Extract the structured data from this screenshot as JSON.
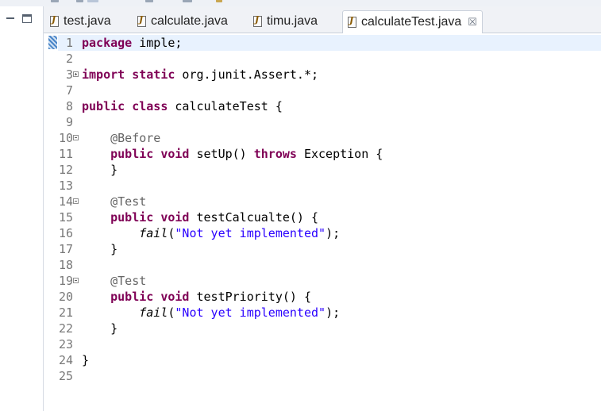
{
  "tabs": [
    {
      "label": "test.java",
      "active": false
    },
    {
      "label": "calculate.java",
      "active": false
    },
    {
      "label": "timu.java",
      "active": false
    },
    {
      "label": "calculateTest.java",
      "active": true
    }
  ],
  "tab_close_glyph": "☒",
  "icons": {
    "tab_file": "java-file-icon",
    "close": "close-icon",
    "minimize": "minimize-icon",
    "maximize": "maximize-icon"
  },
  "colors": {
    "keyword": "#7f0055",
    "annotation": "#646464",
    "string": "#2a00ff",
    "current_line": "#e8f2fe"
  },
  "editor": {
    "current_line": 1,
    "lines": [
      {
        "num": "1",
        "text": "package imple;",
        "segments": [
          [
            "kw",
            "package"
          ],
          [
            "",
            " imple;"
          ]
        ]
      },
      {
        "num": "2",
        "text": "",
        "segments": []
      },
      {
        "num": "3",
        "text": "import static org.junit.Assert.*;",
        "fold": "expand",
        "segments": [
          [
            "kw",
            "import"
          ],
          [
            "",
            " "
          ],
          [
            "kw",
            "static"
          ],
          [
            "",
            " org.junit.Assert.*;"
          ]
        ]
      },
      {
        "num": "7",
        "text": "",
        "segments": []
      },
      {
        "num": "8",
        "text": "public class calculateTest {",
        "segments": [
          [
            "kw",
            "public"
          ],
          [
            "",
            " "
          ],
          [
            "kw",
            "class"
          ],
          [
            "",
            " calculateTest {"
          ]
        ]
      },
      {
        "num": "9",
        "text": "",
        "segments": []
      },
      {
        "num": "10",
        "text": "    @Before",
        "fold": "collapse",
        "segments": [
          [
            "",
            "    "
          ],
          [
            "an",
            "@Before"
          ]
        ]
      },
      {
        "num": "11",
        "text": "    public void setUp() throws Exception {",
        "segments": [
          [
            "",
            "    "
          ],
          [
            "kw",
            "public"
          ],
          [
            "",
            " "
          ],
          [
            "kw",
            "void"
          ],
          [
            "",
            " setUp() "
          ],
          [
            "kw",
            "throws"
          ],
          [
            "",
            " Exception {"
          ]
        ]
      },
      {
        "num": "12",
        "text": "    }",
        "segments": [
          [
            "",
            "    }"
          ]
        ]
      },
      {
        "num": "13",
        "text": "",
        "segments": []
      },
      {
        "num": "14",
        "text": "    @Test",
        "fold": "collapse",
        "segments": [
          [
            "",
            "    "
          ],
          [
            "an",
            "@Test"
          ]
        ]
      },
      {
        "num": "15",
        "text": "    public void testCalcualte() {",
        "segments": [
          [
            "",
            "    "
          ],
          [
            "kw",
            "public"
          ],
          [
            "",
            " "
          ],
          [
            "kw",
            "void"
          ],
          [
            "",
            " testCalcualte() {"
          ]
        ]
      },
      {
        "num": "16",
        "text": "        fail(\"Not yet implemented\");",
        "segments": [
          [
            "",
            "        "
          ],
          [
            "it",
            "fail"
          ],
          [
            "",
            "("
          ],
          [
            "str",
            "\"Not yet implemented\""
          ],
          [
            "",
            ");"
          ]
        ]
      },
      {
        "num": "17",
        "text": "    }",
        "segments": [
          [
            "",
            "    }"
          ]
        ]
      },
      {
        "num": "18",
        "text": "",
        "segments": []
      },
      {
        "num": "19",
        "text": "    @Test",
        "fold": "collapse",
        "segments": [
          [
            "",
            "    "
          ],
          [
            "an",
            "@Test"
          ]
        ]
      },
      {
        "num": "20",
        "text": "    public void testPriority() {",
        "segments": [
          [
            "",
            "    "
          ],
          [
            "kw",
            "public"
          ],
          [
            "",
            " "
          ],
          [
            "kw",
            "void"
          ],
          [
            "",
            " testPriority() {"
          ]
        ]
      },
      {
        "num": "21",
        "text": "        fail(\"Not yet implemented\");",
        "segments": [
          [
            "",
            "        "
          ],
          [
            "it",
            "fail"
          ],
          [
            "",
            "("
          ],
          [
            "str",
            "\"Not yet implemented\""
          ],
          [
            "",
            ");"
          ]
        ]
      },
      {
        "num": "22",
        "text": "    }",
        "segments": [
          [
            "",
            "    }"
          ]
        ]
      },
      {
        "num": "23",
        "text": "",
        "segments": []
      },
      {
        "num": "24",
        "text": "}",
        "segments": [
          [
            "",
            "}"
          ]
        ]
      },
      {
        "num": "25",
        "text": "",
        "segments": []
      }
    ]
  }
}
